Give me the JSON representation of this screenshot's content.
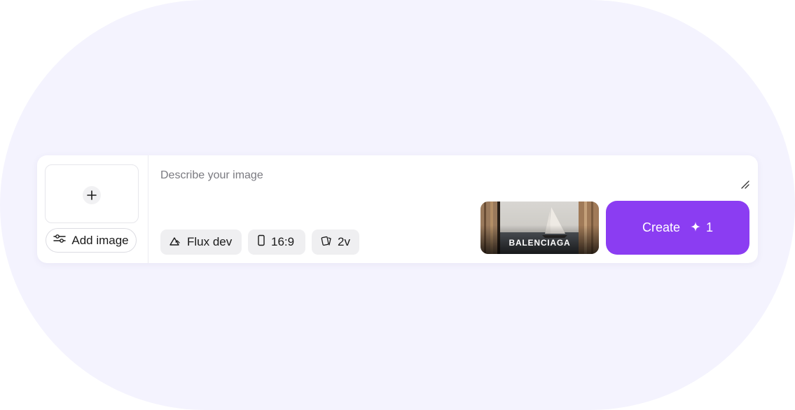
{
  "upload": {
    "add_image_label": "Add image",
    "plus_icon": "plus-icon",
    "sliders_icon": "sliders-icon"
  },
  "prompt": {
    "placeholder": "Describe your image",
    "value": ""
  },
  "options": {
    "model_label": "Flux dev",
    "model_icon": "model-icon",
    "ratio_label": "16:9",
    "ratio_icon": "phone-icon",
    "variations_label": "2v",
    "variations_icon": "cards-icon"
  },
  "style": {
    "label": "BALENCIAGA"
  },
  "create": {
    "label": "Create",
    "credits": "1",
    "sparkle_icon": "sparkle-icon"
  },
  "colors": {
    "accent": "#8b3df2",
    "background_blob": "#f4f3fe",
    "chip_bg": "#efeff1"
  }
}
